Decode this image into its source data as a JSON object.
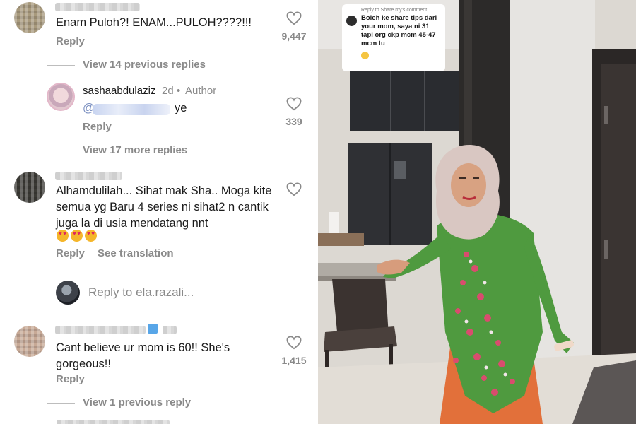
{
  "comments": [
    {
      "text": "Enam Puloh?! ENAM...PULOH????!!!",
      "reply_label": "Reply",
      "likes": "9,447"
    },
    {
      "username": "sashaabdulaziz",
      "age": "2d",
      "separator": "•",
      "author_label": "Author",
      "text_suffix": "ye",
      "mention_prefix": "@",
      "reply_label": "Reply",
      "likes": "339"
    },
    {
      "text": "Alhamdulilah... Sihat mak Sha.. Moga kite semua yg Baru 4 series ni sihat2 n cantik juga la di usia mendatang nnt",
      "reply_label": "Reply",
      "translate_label": "See translation"
    },
    {
      "text": "Cant believe ur mom is 60!! She's gorgeous!!",
      "reply_label": "Reply",
      "likes": "1,415"
    }
  ],
  "view_previous_replies_1": "View 14 previous replies",
  "view_more_replies": "View 17 more replies",
  "view_previous_replies_2": "View 1 previous reply",
  "reply_box_placeholder": "Reply to ela.razali...",
  "video": {
    "reply_header": "Reply to Share.my's comment",
    "reply_text": "Boleh ke share tips dari your mom, saya ni 31 tapi org ckp mcm 45-47 mcm tu"
  },
  "colors": {
    "muted_text": "#8a8a8a",
    "dress_green": "#4f9a3f",
    "skirt_orange": "#e2703a",
    "hijab": "#d9c7c2"
  },
  "icons": [
    "heart-icon",
    "emoji-heart-eyes-icon",
    "emoji-sweat-smile-icon"
  ]
}
